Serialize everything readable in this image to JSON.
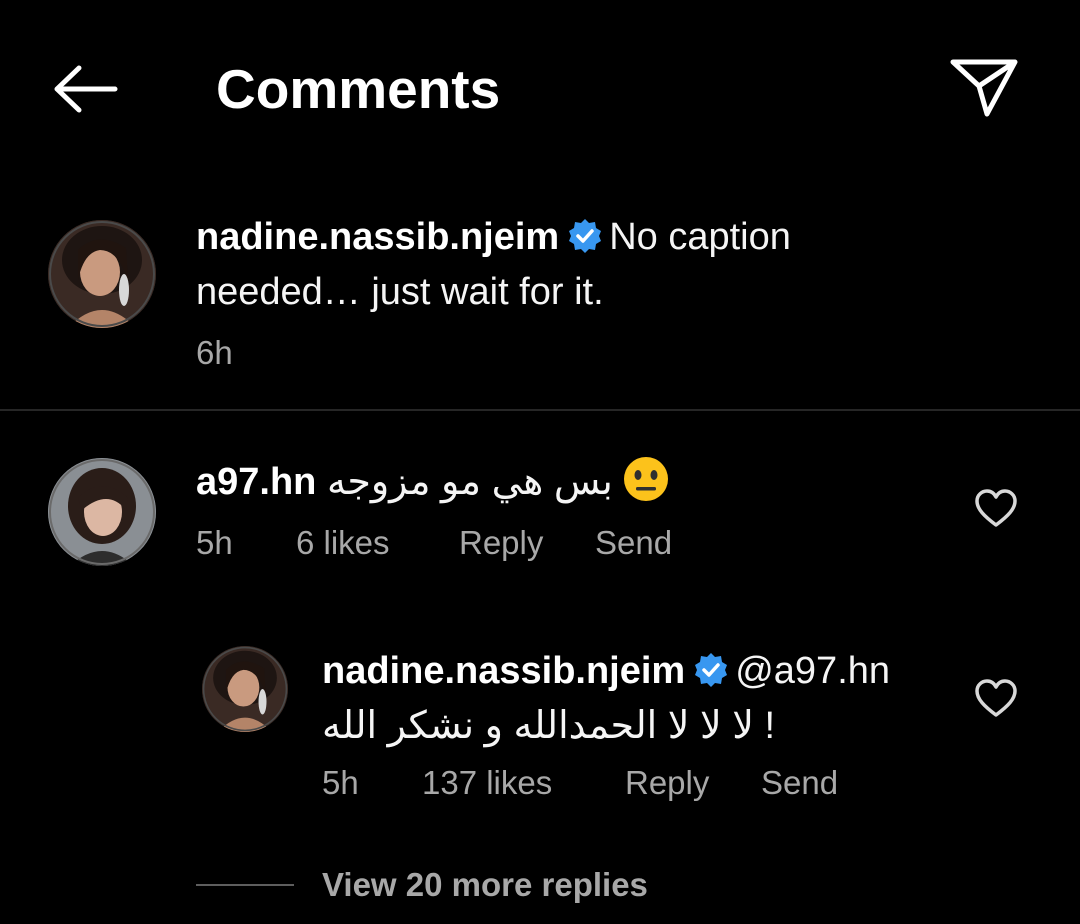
{
  "header": {
    "title": "Comments",
    "back_icon": "arrow-left-icon",
    "share_icon": "paper-plane-icon"
  },
  "caption": {
    "username": "nadine.nassib.njeim",
    "verified": true,
    "text": "No caption needed… just wait for it.",
    "time": "6h"
  },
  "comments": [
    {
      "username": "a97.hn",
      "text": "بس هي مو مزوجه",
      "emoji": "neutral-face",
      "time": "5h",
      "likes": "6 likes",
      "reply_label": "Reply",
      "send_label": "Send"
    }
  ],
  "reply": {
    "username": "nadine.nassib.njeim",
    "verified": true,
    "mention": "@a97.hn",
    "text": "! لا لا لا الحمدالله و نشكر الله",
    "time": "5h",
    "likes": "137 likes",
    "reply_label": "Reply",
    "send_label": "Send"
  },
  "view_replies": {
    "label": "View 20 more replies"
  },
  "colors": {
    "background": "#000000",
    "text_primary": "#ffffff",
    "text_secondary": "#a8a8a8",
    "verified_blue": "#3897f0",
    "emoji_yellow": "#fcc21b"
  }
}
